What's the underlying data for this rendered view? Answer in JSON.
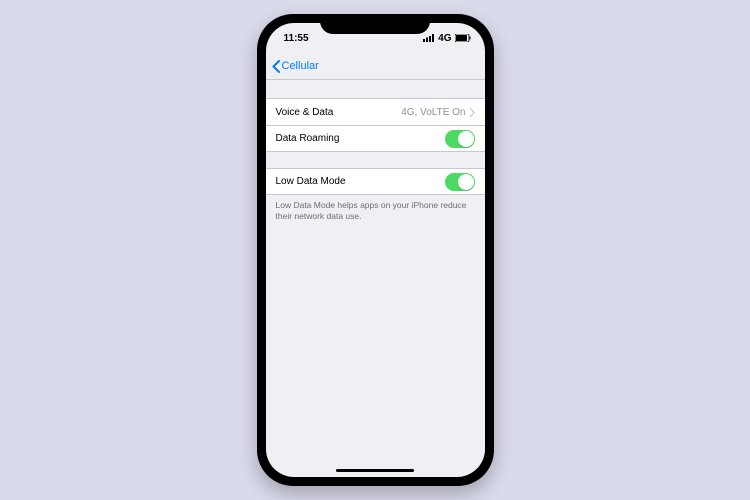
{
  "status": {
    "time": "11:55",
    "network": "4G"
  },
  "nav": {
    "back_label": "Cellular"
  },
  "group1": {
    "voice_data": {
      "label": "Voice & Data",
      "value": "4G, VoLTE On"
    },
    "roaming": {
      "label": "Data Roaming"
    }
  },
  "group2": {
    "low_data": {
      "label": "Low Data Mode"
    },
    "footer": "Low Data Mode helps apps on your iPhone reduce their network data use."
  }
}
